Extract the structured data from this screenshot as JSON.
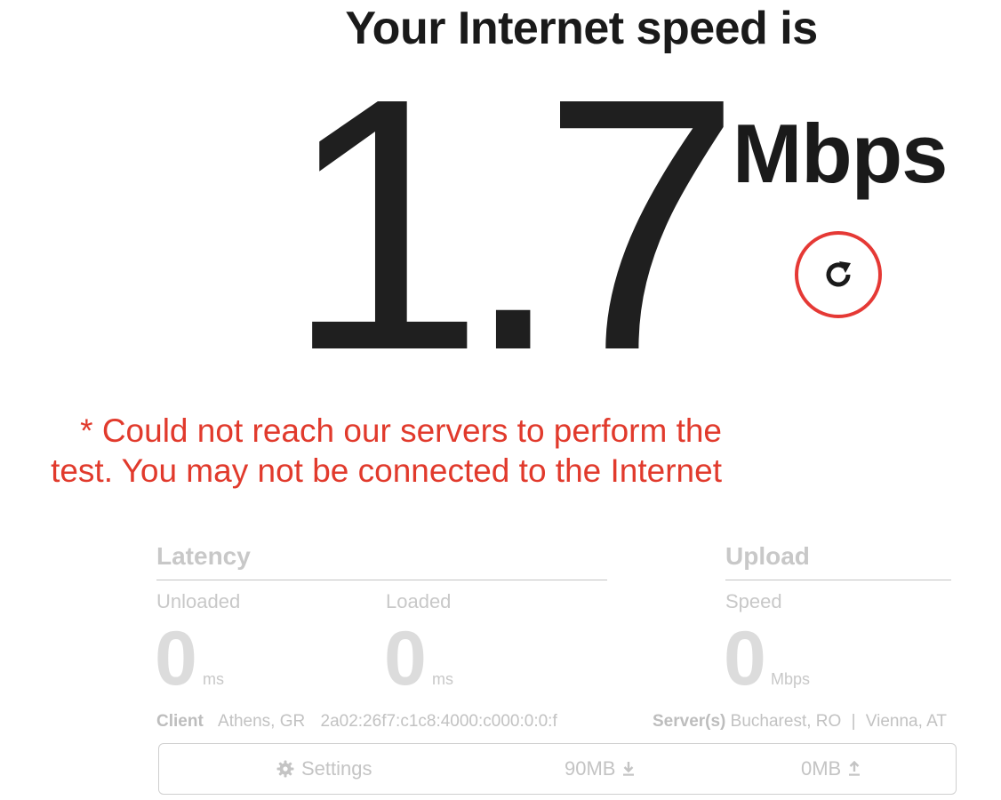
{
  "heading": "Your Internet speed is",
  "speed": {
    "value": "1.7",
    "units": "Mbps"
  },
  "refresh_icon": "refresh-icon",
  "error_message": "* Could not reach our servers to perform the test. You may not be connected to the Internet",
  "latency": {
    "title": "Latency",
    "unloaded": {
      "label": "Unloaded",
      "value": "0",
      "unit": "ms"
    },
    "loaded": {
      "label": "Loaded",
      "value": "0",
      "unit": "ms"
    }
  },
  "upload": {
    "title": "Upload",
    "speed": {
      "label": "Speed",
      "value": "0",
      "unit": "Mbps"
    }
  },
  "client": {
    "label": "Client",
    "location": "Athens, GR",
    "ip": "2a02:26f7:c1c8:4000:c000:0:0:f"
  },
  "servers": {
    "label": "Server(s)",
    "list": [
      "Bucharest, RO",
      "Vienna, AT"
    ],
    "separator": "|"
  },
  "settings_bar": {
    "settings_label": "Settings",
    "settings_icon": "gear-icon",
    "download_size": "90MB",
    "download_icon": "download-arrow-icon",
    "upload_size": "0MB",
    "upload_icon": "upload-arrow-icon"
  },
  "colors": {
    "error": "#e13a2c",
    "accent_ring": "#e53935",
    "muted": "#c8c8c8",
    "text_dark": "#1a1a1a"
  }
}
